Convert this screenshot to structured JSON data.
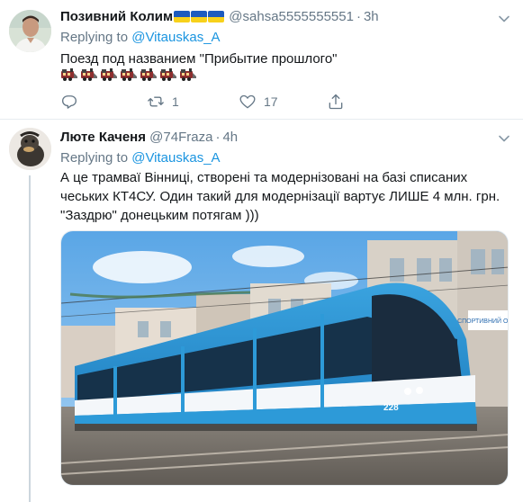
{
  "tweets": [
    {
      "name": "Позивний Колим",
      "handle": "@sahsa5555555551",
      "time": "3h",
      "replying_prefix": "Replying to ",
      "replying_to": "@Vitauskas_A",
      "text": "Поезд под названием \"Прибытие прошлого\"",
      "emoji": "train-emoji",
      "emoji_count": 7,
      "replies": "",
      "retweets": "1",
      "likes": "17"
    },
    {
      "name": "Люте Каченя",
      "handle": "@74Fraza",
      "time": "4h",
      "replying_prefix": "Replying to ",
      "replying_to": "@Vitauskas_A",
      "text": "А це трамваї Вінниці, створені та модернізовані на базі списаних чеських КТ4СУ. Один такий для модернізації  вартує ЛИШЕ 4 млн. грн. \"Заздрю\" донецьким потягам )))",
      "media": {
        "kind": "photo",
        "tram_number": "228",
        "shop_sign": "СПОРТИВНИЙ ОДЯГ"
      }
    }
  ],
  "colors": {
    "accent": "#1b95e0",
    "muted": "#657786",
    "tram_blue": "#2d9ad8",
    "flag_blue": "#1d5bbf",
    "flag_yellow": "#f7d11b"
  },
  "icons": [
    "caret-down-icon",
    "reply-icon",
    "retweet-icon",
    "like-icon",
    "share-icon"
  ]
}
